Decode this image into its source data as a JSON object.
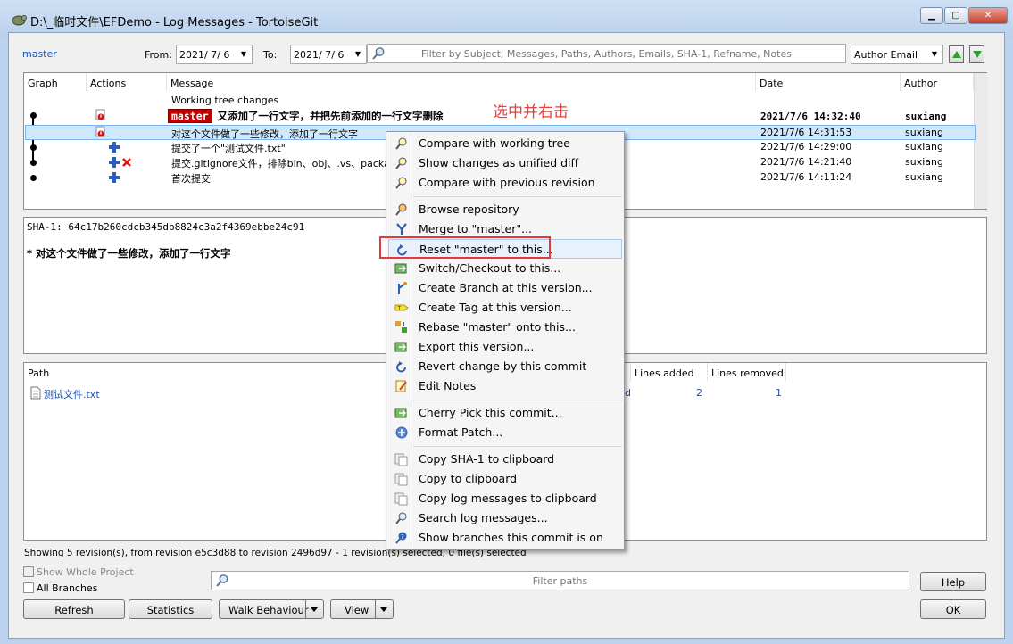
{
  "window": {
    "title": "D:\\_临时文件\\EFDemo - Log Messages - TortoiseGit"
  },
  "toolbar": {
    "branch_link": "master",
    "from_label": "From:",
    "from_value": "2021/ 7/ 6",
    "to_label": "To:",
    "to_value": "2021/ 7/ 6",
    "filter_placeholder": "Filter by Subject, Messages, Paths, Authors, Emails, SHA-1, Refname, Notes",
    "field_select": "Author Email"
  },
  "log": {
    "columns": [
      "Graph",
      "Actions",
      "Message",
      "Date",
      "Author"
    ],
    "working_tree_label": "Working tree changes",
    "rows": [
      {
        "branch": "master",
        "message": "又添加了一行文字，并把先前添加的一行文字删除",
        "date": "2021/7/6 14:32:40",
        "author": "suxiang"
      },
      {
        "message": "对这个文件做了一些修改，添加了一行文字",
        "date": "2021/7/6 14:31:53",
        "author": "suxiang"
      },
      {
        "message": "提交了一个\"测试文件.txt\"",
        "date": "2021/7/6 14:29:00",
        "author": "suxiang"
      },
      {
        "message": "提交.gitignore文件，排除bin、obj、.vs、packag",
        "date": "2021/7/6 14:21:40",
        "author": "suxiang"
      },
      {
        "message": "首次提交",
        "date": "2021/7/6 14:11:24",
        "author": "suxiang"
      }
    ]
  },
  "annotation": "选中并右击",
  "details": {
    "sha_line": "SHA-1: 64c17b260cdcb345db8824c3a2f4369ebbe24c91",
    "message_line": "* 对这个文件做了一些修改，添加了一行文字"
  },
  "files": {
    "columns": {
      "path": "Path",
      "lines_added": "Lines added",
      "lines_removed": "Lines removed"
    },
    "rows": [
      {
        "path": "测试文件.txt",
        "status_fragment": "d",
        "added": "2",
        "removed": "1"
      }
    ]
  },
  "context_menu": {
    "items": [
      {
        "label": "Compare with working tree",
        "icon": "compare-icon"
      },
      {
        "label": "Show changes as unified diff",
        "icon": "diff-icon"
      },
      {
        "label": "Compare with previous revision",
        "icon": "compare-prev-icon"
      },
      {
        "label": "Browse repository",
        "icon": "browse-icon"
      },
      {
        "label": "Merge to \"master\"...",
        "icon": "merge-icon"
      },
      {
        "label": "Reset \"master\" to this...",
        "icon": "reset-icon"
      },
      {
        "label": "Switch/Checkout to this...",
        "icon": "checkout-icon"
      },
      {
        "label": "Create Branch at this version...",
        "icon": "branch-icon"
      },
      {
        "label": "Create Tag at this version...",
        "icon": "tag-icon"
      },
      {
        "label": "Rebase \"master\" onto this...",
        "icon": "rebase-icon"
      },
      {
        "label": "Export this version...",
        "icon": "export-icon"
      },
      {
        "label": "Revert change by this commit",
        "icon": "revert-icon"
      },
      {
        "label": "Edit Notes",
        "icon": "notes-icon"
      },
      {
        "label": "Cherry Pick this commit...",
        "icon": "cherry-pick-icon"
      },
      {
        "label": "Format Patch...",
        "icon": "patch-icon"
      },
      {
        "label": "Copy SHA-1 to clipboard",
        "icon": "copy-icon"
      },
      {
        "label": "Copy to clipboard",
        "icon": "copy-icon"
      },
      {
        "label": "Copy log messages to clipboard",
        "icon": "copy-icon"
      },
      {
        "label": "Search log messages...",
        "icon": "search-icon"
      },
      {
        "label": "Show branches this commit is on",
        "icon": "branches-icon"
      }
    ]
  },
  "status": {
    "text": "Showing 5 revision(s), from revision e5c3d88 to revision 2496d97 - 1 revision(s) selected, 0 file(s) selected"
  },
  "bottom": {
    "show_whole_project": "Show Whole Project",
    "all_branches": "All Branches",
    "path_filter_placeholder": "Filter paths",
    "help": "Help",
    "refresh": "Refresh",
    "statistics": "Statistics",
    "walk_behaviour": "Walk Behaviour",
    "view": "View",
    "ok": "OK"
  },
  "colors": {
    "accent": "#1a4fb5",
    "annotation": "#e8403a",
    "branch_tag": "#c00000",
    "selection": "#cde8ff"
  }
}
